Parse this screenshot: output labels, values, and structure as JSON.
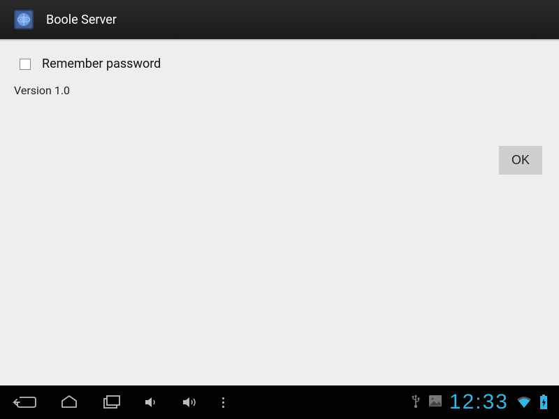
{
  "titlebar": {
    "app_name": "Boole Server"
  },
  "content": {
    "remember_password_label": "Remember password",
    "version_label": "Version 1.0",
    "ok_button_label": "OK"
  },
  "navbar": {
    "clock": "12:33"
  }
}
